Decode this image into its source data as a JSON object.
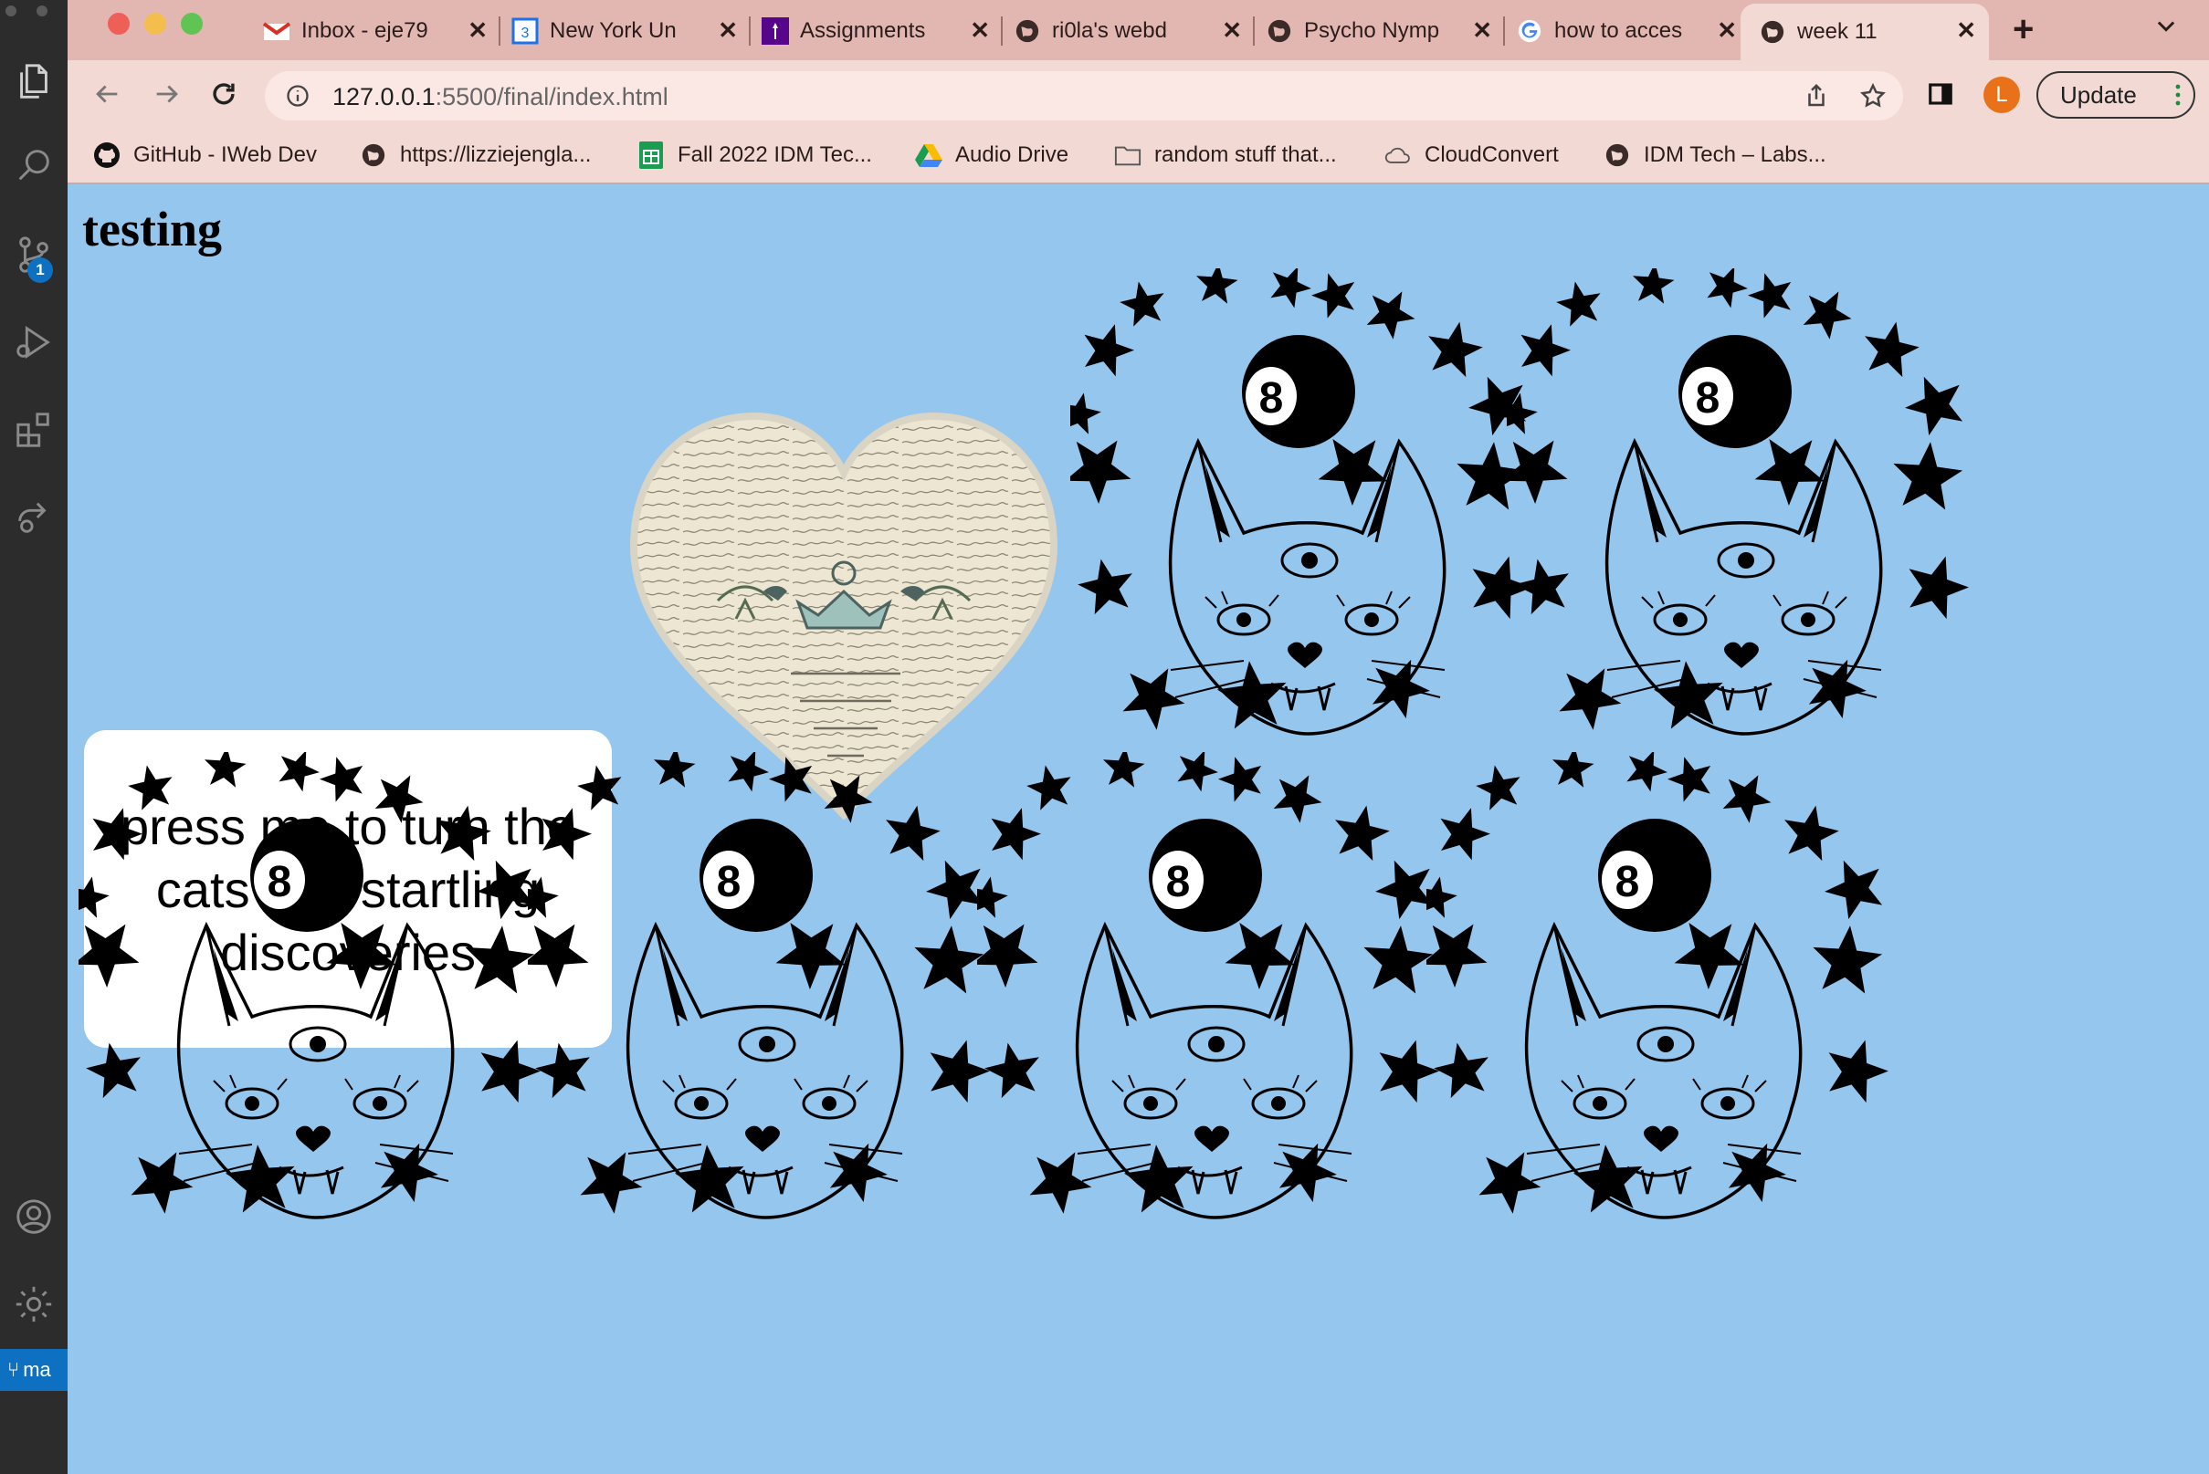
{
  "vscode": {
    "activity_items": [
      "files-icon",
      "search-icon",
      "source-control-icon",
      "run-debug-icon",
      "extensions-icon",
      "remote-explorer-icon"
    ],
    "scm_badge": "1",
    "bottom_items": [
      "accounts-icon",
      "settings-gear-icon"
    ],
    "branch_label": "ma"
  },
  "browser": {
    "tabs": [
      {
        "title": "Inbox - eje79",
        "icon": "gmail-icon"
      },
      {
        "title": "New York Un",
        "icon": "calendar-icon"
      },
      {
        "title": "Assignments",
        "icon": "nyu-torch-icon"
      },
      {
        "title": "ri0la's webd",
        "icon": "globe-icon"
      },
      {
        "title": "Psycho Nymp",
        "icon": "globe-icon"
      },
      {
        "title": "how to acces",
        "icon": "google-icon"
      },
      {
        "title": "week 11",
        "icon": "globe-icon",
        "active": true
      }
    ],
    "new_tab_label": "+",
    "url_host": "127.0.0.1",
    "url_path": ":5500/final/index.html",
    "profile_initial": "L",
    "update_label": "Update",
    "bookmarks": [
      {
        "label": "GitHub - IWeb Dev",
        "icon": "github-icon"
      },
      {
        "label": "https://lizziejengla...",
        "icon": "globe-icon"
      },
      {
        "label": "Fall 2022 IDM Tec...",
        "icon": "sheets-icon"
      },
      {
        "label": "Audio Drive",
        "icon": "drive-icon"
      },
      {
        "label": "random stuff that...",
        "icon": "folder-icon"
      },
      {
        "label": "CloudConvert",
        "icon": "cloud-icon"
      },
      {
        "label": "IDM Tech – Labs...",
        "icon": "globe-icon"
      }
    ]
  },
  "page": {
    "heading": "testing",
    "button_label": "press me to turn the cats into startling discoveries",
    "cat_count": 6
  },
  "colors": {
    "page_bg": "#94c6ee",
    "tabstrip_bg": "#e3b7b1",
    "toolbar_bg": "#f3d9d4",
    "vscode_bg": "#2c2c2c",
    "accent_blue": "#0e70c0",
    "profile_orange": "#e8711a"
  }
}
